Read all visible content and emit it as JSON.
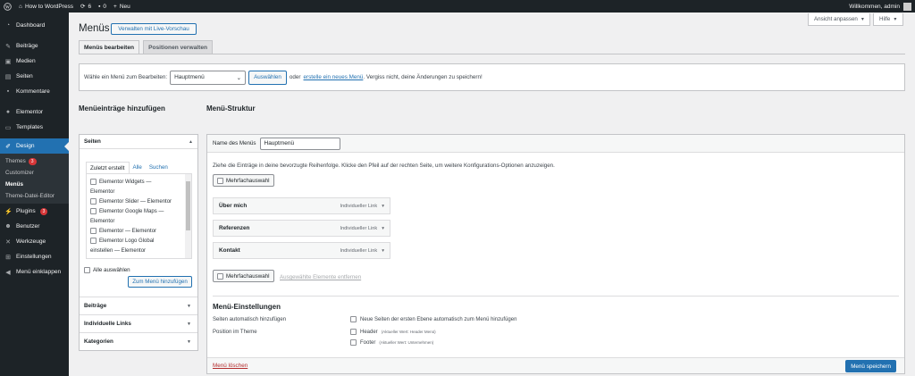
{
  "adminbar": {
    "site_name": "How to WordPress",
    "updates_count": "6",
    "comments_count": "0",
    "new_label": "Neu",
    "welcome": "Willkommen, admin"
  },
  "sidebar": {
    "items": [
      {
        "label": "Dashboard",
        "icon": "dashboard-icon"
      },
      {
        "label": "Beiträge",
        "icon": "pin-icon"
      },
      {
        "label": "Medien",
        "icon": "media-icon"
      },
      {
        "label": "Seiten",
        "icon": "pages-icon"
      },
      {
        "label": "Kommentare",
        "icon": "comments-icon"
      },
      {
        "label": "Elementor",
        "icon": "elementor-icon"
      },
      {
        "label": "Templates",
        "icon": "templates-icon"
      },
      {
        "label": "Design",
        "icon": "brush-icon"
      },
      {
        "label": "Plugins",
        "icon": "plugin-icon",
        "badge": "3"
      },
      {
        "label": "Benutzer",
        "icon": "user-icon"
      },
      {
        "label": "Werkzeuge",
        "icon": "wrench-icon"
      },
      {
        "label": "Einstellungen",
        "icon": "settings-icon"
      },
      {
        "label": "Menü einklappen",
        "icon": "collapse-icon"
      }
    ],
    "design_sub": [
      {
        "label": "Themes",
        "badge": "3"
      },
      {
        "label": "Customizer"
      },
      {
        "label": "Menüs"
      },
      {
        "label": "Theme-Datei-Editor"
      }
    ]
  },
  "page": {
    "title": "Menüs",
    "live_preview": "Verwalten mit Live-Vorschau",
    "screen_options": "Ansicht anpassen",
    "help": "Hilfe",
    "tabs": [
      "Menüs bearbeiten",
      "Positionen verwalten"
    ]
  },
  "select_bar": {
    "label": "Wähle ein Menü zum Bearbeiten:",
    "selected": "Hauptmenü",
    "button": "Auswählen",
    "text_or": "oder",
    "link": "erstelle ein neues Menü",
    "text_after": ". Vergiss nicht, deine Änderungen zu speichern!"
  },
  "add_items": {
    "heading": "Menüeinträge hinzufügen",
    "pages_heading": "Seiten",
    "tabs": [
      "Zuletzt erstellt",
      "Alle",
      "Suchen"
    ],
    "list": [
      {
        "label": "Elementor Widgets —",
        "cont": "Elementor"
      },
      {
        "label": "Elementor Slider — Elementor"
      },
      {
        "label": "Elementor Google Maps —",
        "cont": "Elementor"
      },
      {
        "label": "Elementor — Elementor"
      },
      {
        "label": "Elementor Logo Global",
        "cont": "einstellen — Elementor"
      }
    ],
    "select_all": "Alle auswählen",
    "add_button": "Zum Menü hinzufügen",
    "accordions": [
      "Beiträge",
      "Individuelle Links",
      "Kategorien"
    ]
  },
  "structure": {
    "heading": "Menü-Struktur",
    "name_label": "Name des Menüs",
    "name_value": "Hauptmenü",
    "instructions": "Ziehe die Einträge in deine bevorzugte Reihenfolge. Klicke den Pfeil auf der rechten Seite, um weitere Konfigurations-Optionen anzuzeigen.",
    "multi_select": "Mehrfachauswahl",
    "items": [
      {
        "label": "Über mich",
        "type": "Individueller Link"
      },
      {
        "label": "Referenzen",
        "type": "Individueller Link"
      },
      {
        "label": "Kontakt",
        "type": "Individueller Link"
      }
    ],
    "remove_selected": "Ausgewählte Elemente entfernen",
    "settings_heading": "Menü-Einstellungen",
    "auto_add_label": "Seiten automatisch hinzufügen",
    "auto_add_option": "Neue Seiten der ersten Ebene automatisch zum Menü hinzufügen",
    "position_label": "Position im Theme",
    "positions": [
      {
        "label": "Header",
        "note": "(Aktueller Wert: Header Menü)"
      },
      {
        "label": "Footer",
        "note": "(Aktueller Wert: Unternehmen)"
      }
    ],
    "delete": "Menü löschen",
    "save": "Menü speichern"
  }
}
